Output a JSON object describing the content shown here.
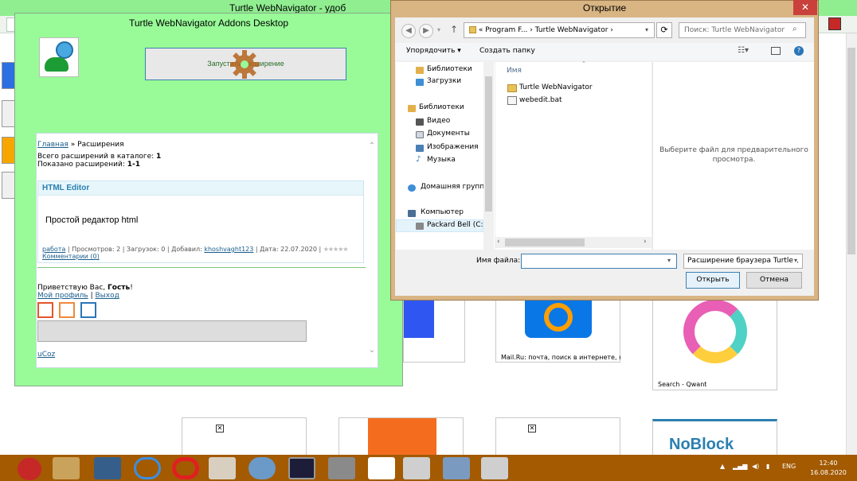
{
  "background_window": {
    "title": "Turtle WebNavigator - удоб",
    "tiles": [
      {
        "caption": "Mail.Ru: почта, поиск в интернете, новости, игр"
      },
      {
        "caption": "Search - Qwant"
      },
      {
        "caption": "NoBlock"
      }
    ]
  },
  "addons_window": {
    "title": "Turtle WebNavigator Addons Desktop",
    "run_button": "Запустить расширение",
    "breadcrumb": {
      "home": "Главная",
      "sep": "»",
      "current": "Расширения"
    },
    "stats": {
      "total_label": "Всего расширений в каталоге:",
      "total_value": "1",
      "shown_label": "Показано расширений:",
      "shown_value": "1-1"
    },
    "item": {
      "title": "HTML Editor",
      "description": "Простой редактор html",
      "category": "работа",
      "views": "| Просмотров: 2 | Загрузок: 0 | Добавил:",
      "author": "khoshvaght123",
      "date": "| Дата: 22.07.2020 |",
      "comments": "Комментарии (0)"
    },
    "greeting": {
      "prefix": "Приветствую Вас,",
      "user": "Гость",
      "suffix": "!"
    },
    "profile_link": "Мой профиль",
    "divider": "|",
    "logout_link": "Выход",
    "footer_link": "uCoz"
  },
  "dialog": {
    "title": "Открытие",
    "path": {
      "root": "«",
      "segment1": "Program F...",
      "arrow": "›",
      "segment2": "Turtle WebNavigator",
      "arrow2": "›"
    },
    "search_placeholder": "Поиск: Turtle WebNavigator",
    "toolbar": {
      "organize": "Упорядочить ▾",
      "new_folder": "Создать папку"
    },
    "nav_items": [
      {
        "label": "Библиотеки",
        "icon": "library-icon"
      },
      {
        "label": "Загрузки",
        "icon": "downloads-icon"
      },
      {
        "label": "Библиотеки",
        "icon": "library-icon"
      },
      {
        "label": "Видео",
        "icon": "video-icon"
      },
      {
        "label": "Документы",
        "icon": "documents-icon"
      },
      {
        "label": "Изображения",
        "icon": "pictures-icon"
      },
      {
        "label": "Музыка",
        "icon": "music-icon"
      },
      {
        "label": "Домашняя группа",
        "icon": "homegroup-icon"
      },
      {
        "label": "Компьютер",
        "icon": "computer-icon"
      },
      {
        "label": "Packard Bell (C:)",
        "icon": "drive-icon"
      }
    ],
    "column_header": "Имя",
    "files": [
      {
        "name": "Turtle WebNavigator",
        "icon": "folder-icon"
      },
      {
        "name": "webedit.bat",
        "icon": "batch-file-icon"
      }
    ],
    "preview_text": "Выберите файл для предварительного просмотра.",
    "filename_label": "Имя файла:",
    "filename_value": "",
    "filetype": "Расширение браузера Turtle \\",
    "open_button": "Открыть",
    "cancel_button": "Отмена",
    "close_symbol": "✕"
  },
  "taskbar": {
    "language": "ENG",
    "time": "12:40",
    "date": "16.08.2020",
    "tray_arrow": "▲"
  },
  "colors": {
    "addons_bg": "#98fb98",
    "dialog_frame": "#d9b584",
    "taskbar": "#a35a00",
    "link": "#1a5e8c",
    "accent": "#3c7fb1"
  }
}
